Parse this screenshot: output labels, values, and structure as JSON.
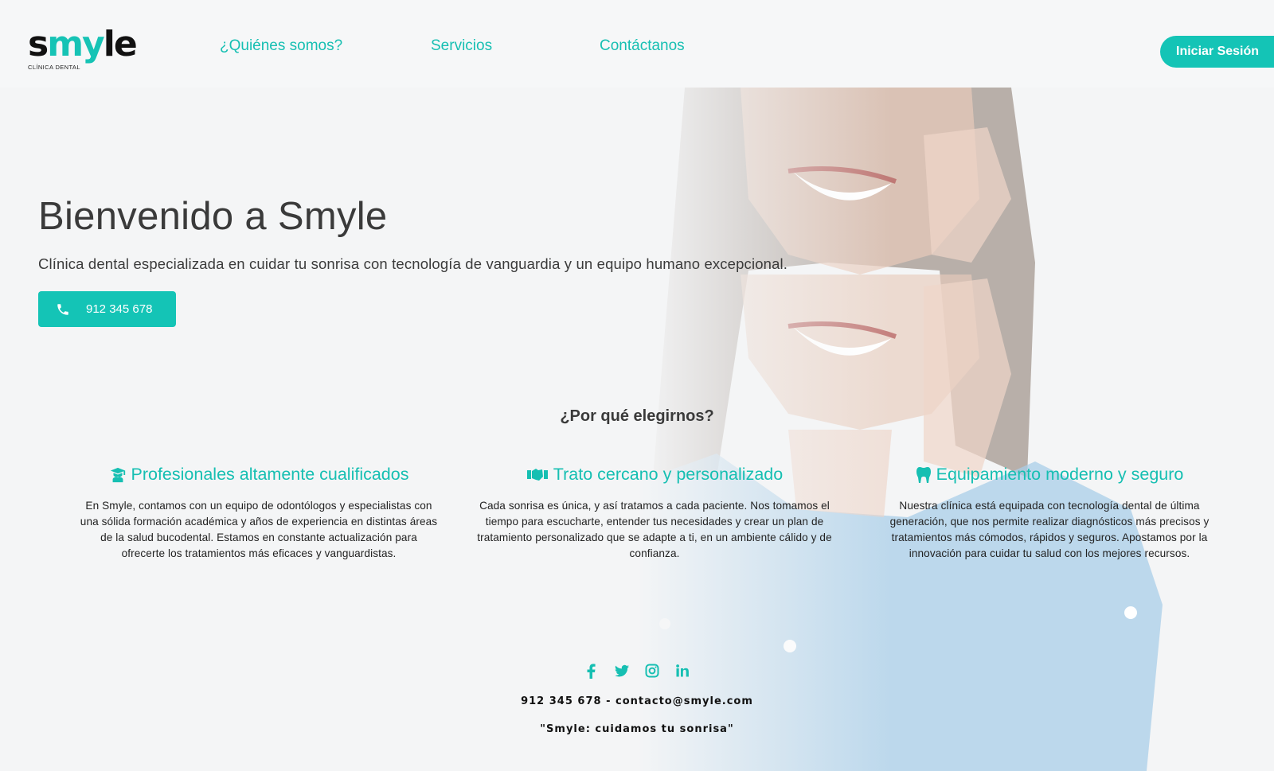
{
  "brand": {
    "logo_prefix": "s",
    "logo_accent": "my",
    "logo_suffix": "le",
    "logo_subtitle": "CLÍNICA DENTAL",
    "accent_color": "#14c4b6"
  },
  "nav": {
    "items": [
      {
        "label": "¿Quiénes somos?"
      },
      {
        "label": "Servicios"
      },
      {
        "label": "Contáctanos"
      }
    ],
    "login_label": "Iniciar Sesión"
  },
  "hero": {
    "title": "Bienvenido a Smyle",
    "subtitle": "Clínica dental especializada en cuidar tu sonrisa con tecnología de vanguardia y un equipo humano excepcional.",
    "phone_label": "912 345 678",
    "phone_icon": "phone-icon"
  },
  "why": {
    "title": "¿Por qué elegirnos?",
    "features": [
      {
        "icon": "graduate-icon",
        "title": "Profesionales altamente cualificados",
        "text": "En Smyle, contamos con un equipo de odontólogos y especialistas con una sólida formación académica y años de experiencia en distintas áreas de la salud bucodental. Estamos en constante actualización para ofrecerte los tratamientos más eficaces y vanguardistas."
      },
      {
        "icon": "handshake-icon",
        "title": "Trato cercano y personalizado",
        "text": "Cada sonrisa es única, y así tratamos a cada paciente. Nos tomamos el tiempo para escucharte, entender tus necesidades y crear un plan de tratamiento personalizado que se adapte a ti, en un ambiente cálido y de confianza."
      },
      {
        "icon": "tooth-icon",
        "title": "Equipamiento moderno y seguro",
        "text": "Nuestra clínica está equipada con tecnología dental de última generación, que nos permite realizar diagnósticos más precisos y tratamientos más cómodos, rápidos y seguros. Apostamos por la innovación para cuidar tu salud con los mejores recursos."
      }
    ]
  },
  "footer": {
    "social": [
      "facebook-icon",
      "twitter-icon",
      "instagram-icon",
      "linkedin-icon"
    ],
    "contact": "912 345 678 - contacto@smyle.com",
    "quote": "\"Smyle: cuidamos tu sonrisa\""
  }
}
